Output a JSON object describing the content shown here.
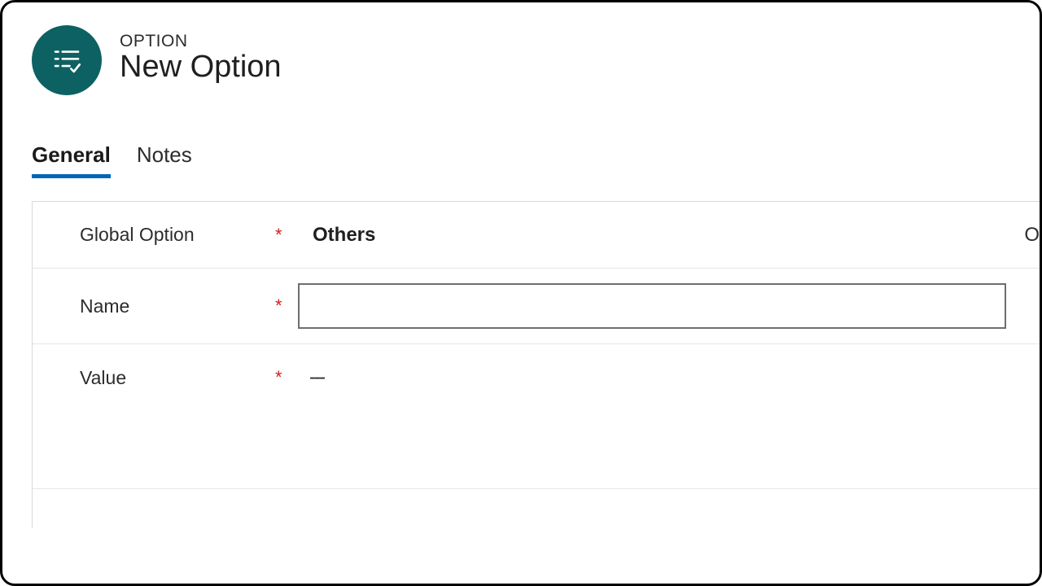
{
  "header": {
    "entity_type": "OPTION",
    "title": "New Option",
    "icon": "option-list-icon"
  },
  "tabs": [
    {
      "label": "General",
      "active": true
    },
    {
      "label": "Notes",
      "active": false
    }
  ],
  "form": {
    "global_option": {
      "label": "Global Option",
      "required": "*",
      "value": "Others",
      "trailing_glyph": "O"
    },
    "name": {
      "label": "Name",
      "required": "*",
      "value": ""
    },
    "value_field": {
      "label": "Value",
      "required": "*",
      "placeholder_display": "---"
    }
  },
  "colors": {
    "accent_circle": "#0d6163",
    "tab_underline": "#0067b8",
    "required_asterisk": "#d22020",
    "border_gray": "#d9d9d9"
  }
}
